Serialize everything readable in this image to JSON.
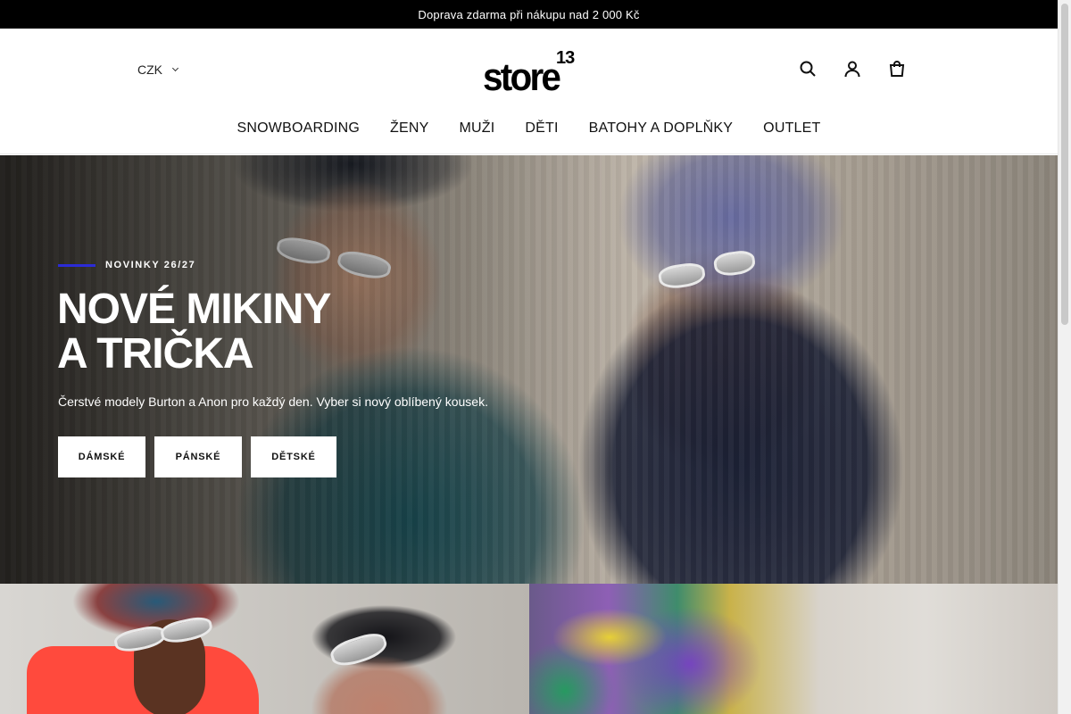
{
  "announcement": {
    "text": "Doprava zdarma při nákupu nad 2 000 Kč"
  },
  "header": {
    "currency": {
      "label": "CZK"
    },
    "logo": {
      "word": "store",
      "superscript": "13"
    },
    "icons": [
      "search-icon",
      "user-icon",
      "cart-icon"
    ]
  },
  "nav": {
    "items": [
      {
        "label": "SNOWBOARDING"
      },
      {
        "label": "ŽENY"
      },
      {
        "label": "MUŽI"
      },
      {
        "label": "DĚTI"
      },
      {
        "label": "BATOHY A DOPLŇKY"
      },
      {
        "label": "OUTLET"
      }
    ]
  },
  "hero": {
    "eyebrow": "NOVINKY 26/27",
    "title_line1": "NOVÉ MIKINY",
    "title_line2": "A TRIČKA",
    "subtitle": "Čerstvé modely Burton a Anon pro každý den. Vyber si nový oblíbený kousek.",
    "buttons": [
      {
        "label": "DÁMSKÉ"
      },
      {
        "label": "PÁNSKÉ"
      },
      {
        "label": "DĚTSKÉ"
      }
    ],
    "accent_color": "#2b2bd6"
  }
}
